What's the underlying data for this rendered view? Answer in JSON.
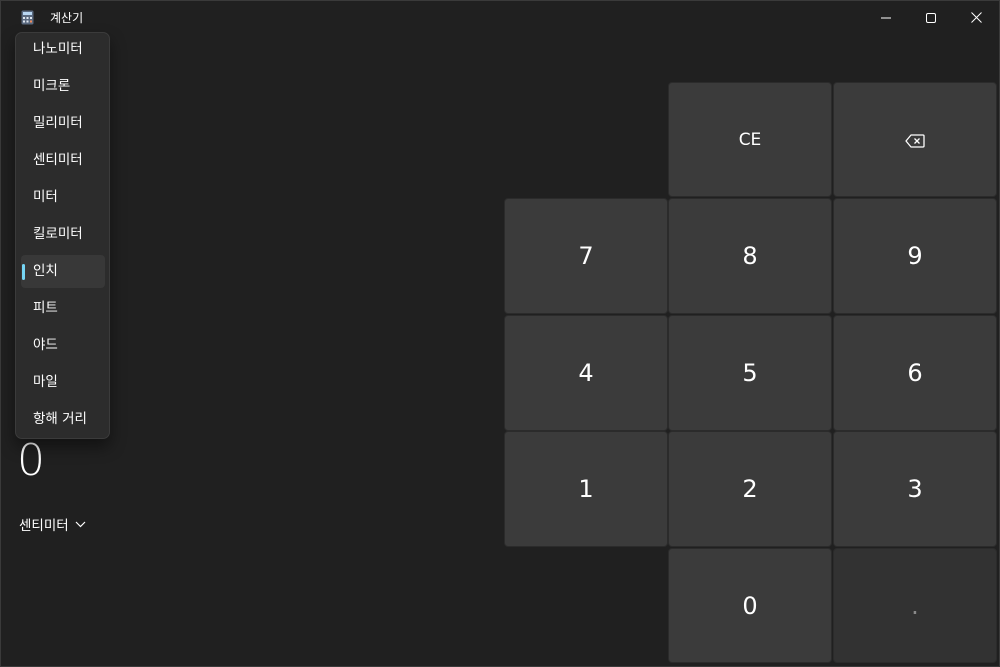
{
  "window": {
    "title": "계산기",
    "icon": "calculator-icon"
  },
  "caption_buttons": {
    "minimize": "minimize-icon",
    "maximize": "maximize-icon",
    "close": "close-icon"
  },
  "unit_menu": {
    "items": [
      "나노미터",
      "미크론",
      "밀리미터",
      "센티미터",
      "미터",
      "킬로미터",
      "인치",
      "피트",
      "야드",
      "마일",
      "항해 거리"
    ],
    "selected": "인치",
    "indicator_color": "#76d6f5"
  },
  "converter": {
    "value": "0",
    "unit": "센티미터",
    "unit_dropdown_icon": "chevron-down-icon"
  },
  "keypad": {
    "ce": "CE",
    "backspace_icon": "backspace-icon",
    "digits": {
      "7": "7",
      "8": "8",
      "9": "9",
      "4": "4",
      "5": "5",
      "6": "6",
      "1": "1",
      "2": "2",
      "3": "3",
      "0": "0"
    },
    "decimal": "."
  }
}
